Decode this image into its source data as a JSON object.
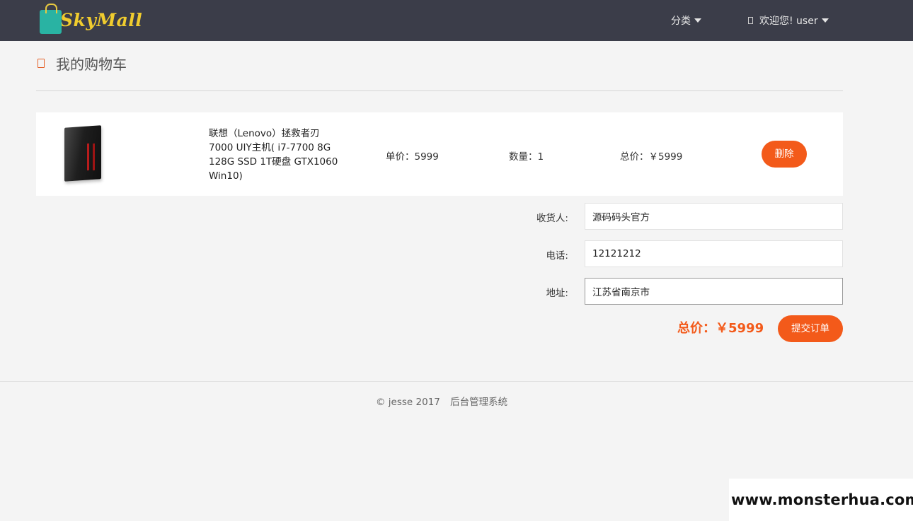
{
  "brand": {
    "name": "SkyMall",
    "colors": {
      "navbar": "#3b3d49",
      "accent": "#f35a1a",
      "logo_text": "#f0cc2e",
      "logo_bag": "#29b3a3"
    }
  },
  "nav": {
    "category_label": "分类",
    "user_label": "欢迎您! user"
  },
  "page": {
    "title": "我的购物车"
  },
  "cart": {
    "items": [
      {
        "name": "联想（Lenovo）拯救者刃7000 UIY主机( i7-7700 8G 128G SSD 1T硬盘 GTX1060 Win10)",
        "unit_price_text": "单价：5999",
        "quantity_text": "数量：1",
        "total_text": "总价：￥5999",
        "delete_label": "删除"
      }
    ]
  },
  "form": {
    "receiver_label": "收货人:",
    "receiver_value": "源码码头官方",
    "phone_label": "电话:",
    "phone_value": "12121212",
    "address_label": "地址:",
    "address_value": "江苏省南京市"
  },
  "summary": {
    "total_text": "总价：￥5999",
    "submit_label": "提交订单"
  },
  "footer": {
    "copyright": "© jesse 2017",
    "admin_link": "后台管理系统"
  },
  "watermark": {
    "text": "www.monsterhua.com"
  }
}
